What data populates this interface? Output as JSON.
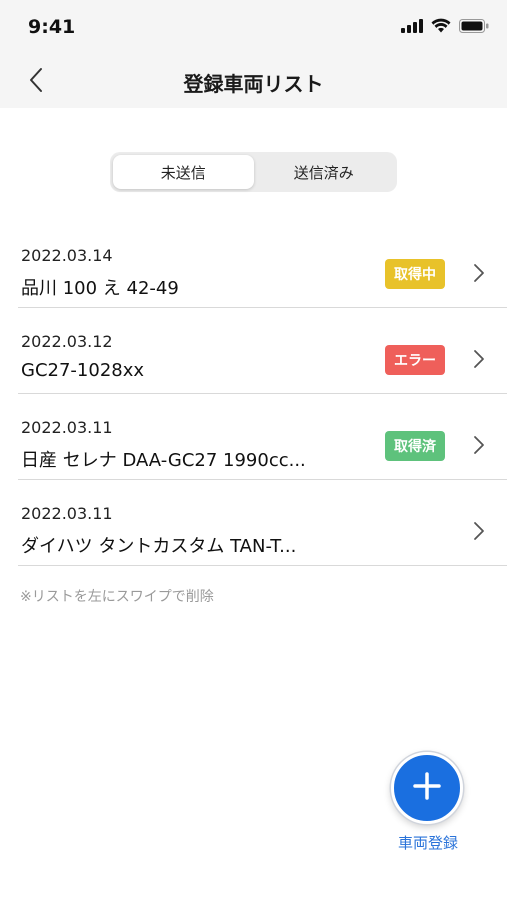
{
  "status_bar": {
    "time": "9:41"
  },
  "nav": {
    "title": "登録車両リスト"
  },
  "tabs": [
    {
      "label": "未送信",
      "active": true
    },
    {
      "label": "送信済み",
      "active": false
    }
  ],
  "vehicles": [
    {
      "date": "2022.03.14",
      "title": "品川 100 え 42-49",
      "status": "取得中",
      "status_color": "#e8c22a"
    },
    {
      "date": "2022.03.12",
      "title": "GC27-1028xx",
      "status": "エラー",
      "status_color": "#ef5f5a"
    },
    {
      "date": "2022.03.11",
      "title": "日産 セレナ DAA-GC27 1990cc...",
      "status": "取得済",
      "status_color": "#5ec27c"
    },
    {
      "date": "2022.03.11",
      "title": "ダイハツ タントカスタム TAN-T...",
      "status": "",
      "status_color": ""
    }
  ],
  "hint": "※リストを左にスワイプで削除",
  "fab": {
    "label": "車両登録",
    "icon": "plus-icon",
    "color": "#1a6fe0"
  },
  "colors": {
    "accent": "#1a6fe0",
    "link": "#2a73d9",
    "background": "#ffffff",
    "header_bg": "#f5f5f5"
  }
}
